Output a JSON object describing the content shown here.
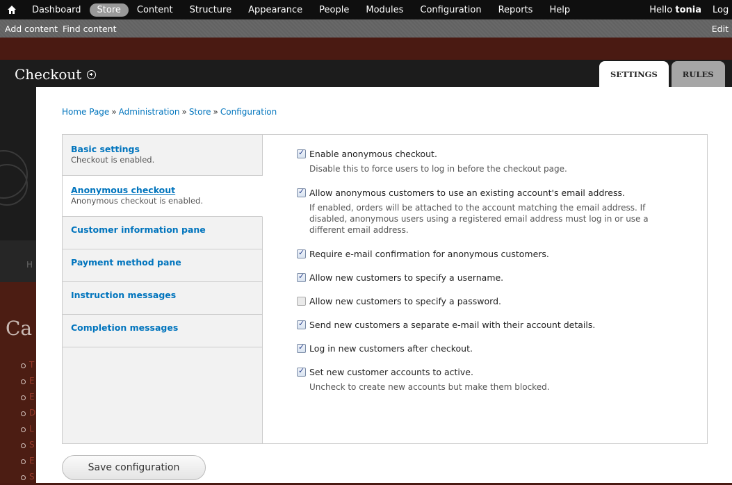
{
  "toolbar": {
    "menu": [
      "Dashboard",
      "Store",
      "Content",
      "Structure",
      "Appearance",
      "People",
      "Modules",
      "Configuration",
      "Reports",
      "Help"
    ],
    "active_menu": "Store",
    "hello_prefix": "Hello ",
    "username": "tonia",
    "logout": "Log out",
    "shortcuts": [
      "Add content",
      "Find content"
    ],
    "edit_shortcuts": "Edit"
  },
  "overlay": {
    "title": "Checkout",
    "tabs": [
      "SETTINGS",
      "RULES"
    ],
    "active_tab": "SETTINGS",
    "breadcrumb": [
      "Home Page",
      "Administration",
      "Store",
      "Configuration"
    ]
  },
  "vertical_tabs": [
    {
      "label": "Basic settings",
      "summary": "Checkout is enabled."
    },
    {
      "label": "Anonymous checkout",
      "summary": "Anonymous checkout is enabled.",
      "selected": true
    },
    {
      "label": "Customer information pane",
      "summary": ""
    },
    {
      "label": "Payment method pane",
      "summary": ""
    },
    {
      "label": "Instruction messages",
      "summary": ""
    },
    {
      "label": "Completion messages",
      "summary": ""
    }
  ],
  "options": [
    {
      "label": "Enable anonymous checkout.",
      "checked": true,
      "description": "Disable this to force users to log in before the checkout page."
    },
    {
      "label": "Allow anonymous customers to use an existing account's email address.",
      "checked": true,
      "description": "If enabled, orders will be attached to the account matching the email address. If disabled, anonymous users using a registered email address must log in or use a different email address."
    },
    {
      "label": "Require e-mail confirmation for anonymous customers.",
      "checked": true,
      "description": ""
    },
    {
      "label": "Allow new customers to specify a username.",
      "checked": true,
      "description": ""
    },
    {
      "label": "Allow new customers to specify a password.",
      "checked": false,
      "description": ""
    },
    {
      "label": "Send new customers a separate e-mail with their account details.",
      "checked": true,
      "description": ""
    },
    {
      "label": "Log in new customers after checkout.",
      "checked": true,
      "description": ""
    },
    {
      "label": "Set new customer accounts to active.",
      "checked": true,
      "description": "Uncheck to create new accounts but make them blocked."
    }
  ],
  "save_button": "Save configuration",
  "background": {
    "heading": "Ca",
    "letter": "H",
    "bullet_letters": [
      "T",
      "E",
      "E",
      "D",
      "L",
      "S",
      "E",
      "S"
    ]
  }
}
